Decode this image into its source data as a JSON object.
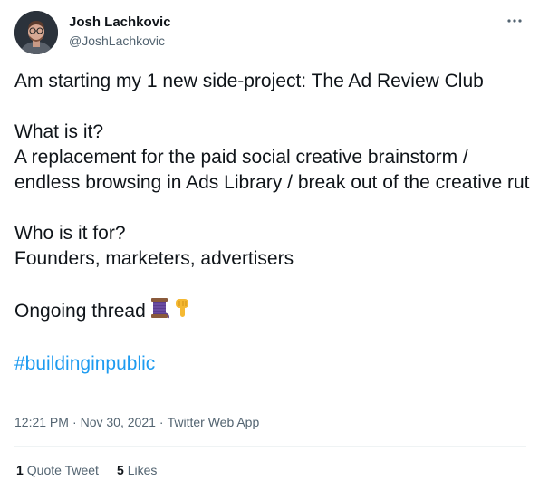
{
  "author": {
    "display_name": "Josh Lachkovic",
    "handle": "@JoshLachkovic"
  },
  "body": {
    "line_intro": "Am starting my 1 new side-project: The Ad Review Club",
    "q1": "What is it?",
    "a1": "A replacement for the paid social creative brainstorm / endless browsing in Ads Library / break out of the creative rut",
    "q2": "Who is it for?",
    "a2": "Founders, marketers, advertisers",
    "thread_label": "Ongoing thread",
    "emojis": [
      "thread-spool-icon",
      "pointing-down-icon"
    ],
    "hashtag": "#buildinginpublic"
  },
  "meta": {
    "time": "12:21 PM",
    "separator": "·",
    "date": "Nov 30, 2021",
    "source": "Twitter Web App"
  },
  "stats": {
    "quote_count": "1",
    "quote_label": "Quote Tweet",
    "likes_count": "5",
    "likes_label": "Likes"
  },
  "colors": {
    "link": "#1d9bf0",
    "text": "#0f1419",
    "secondary": "#536471",
    "divider": "#eff3f4"
  }
}
